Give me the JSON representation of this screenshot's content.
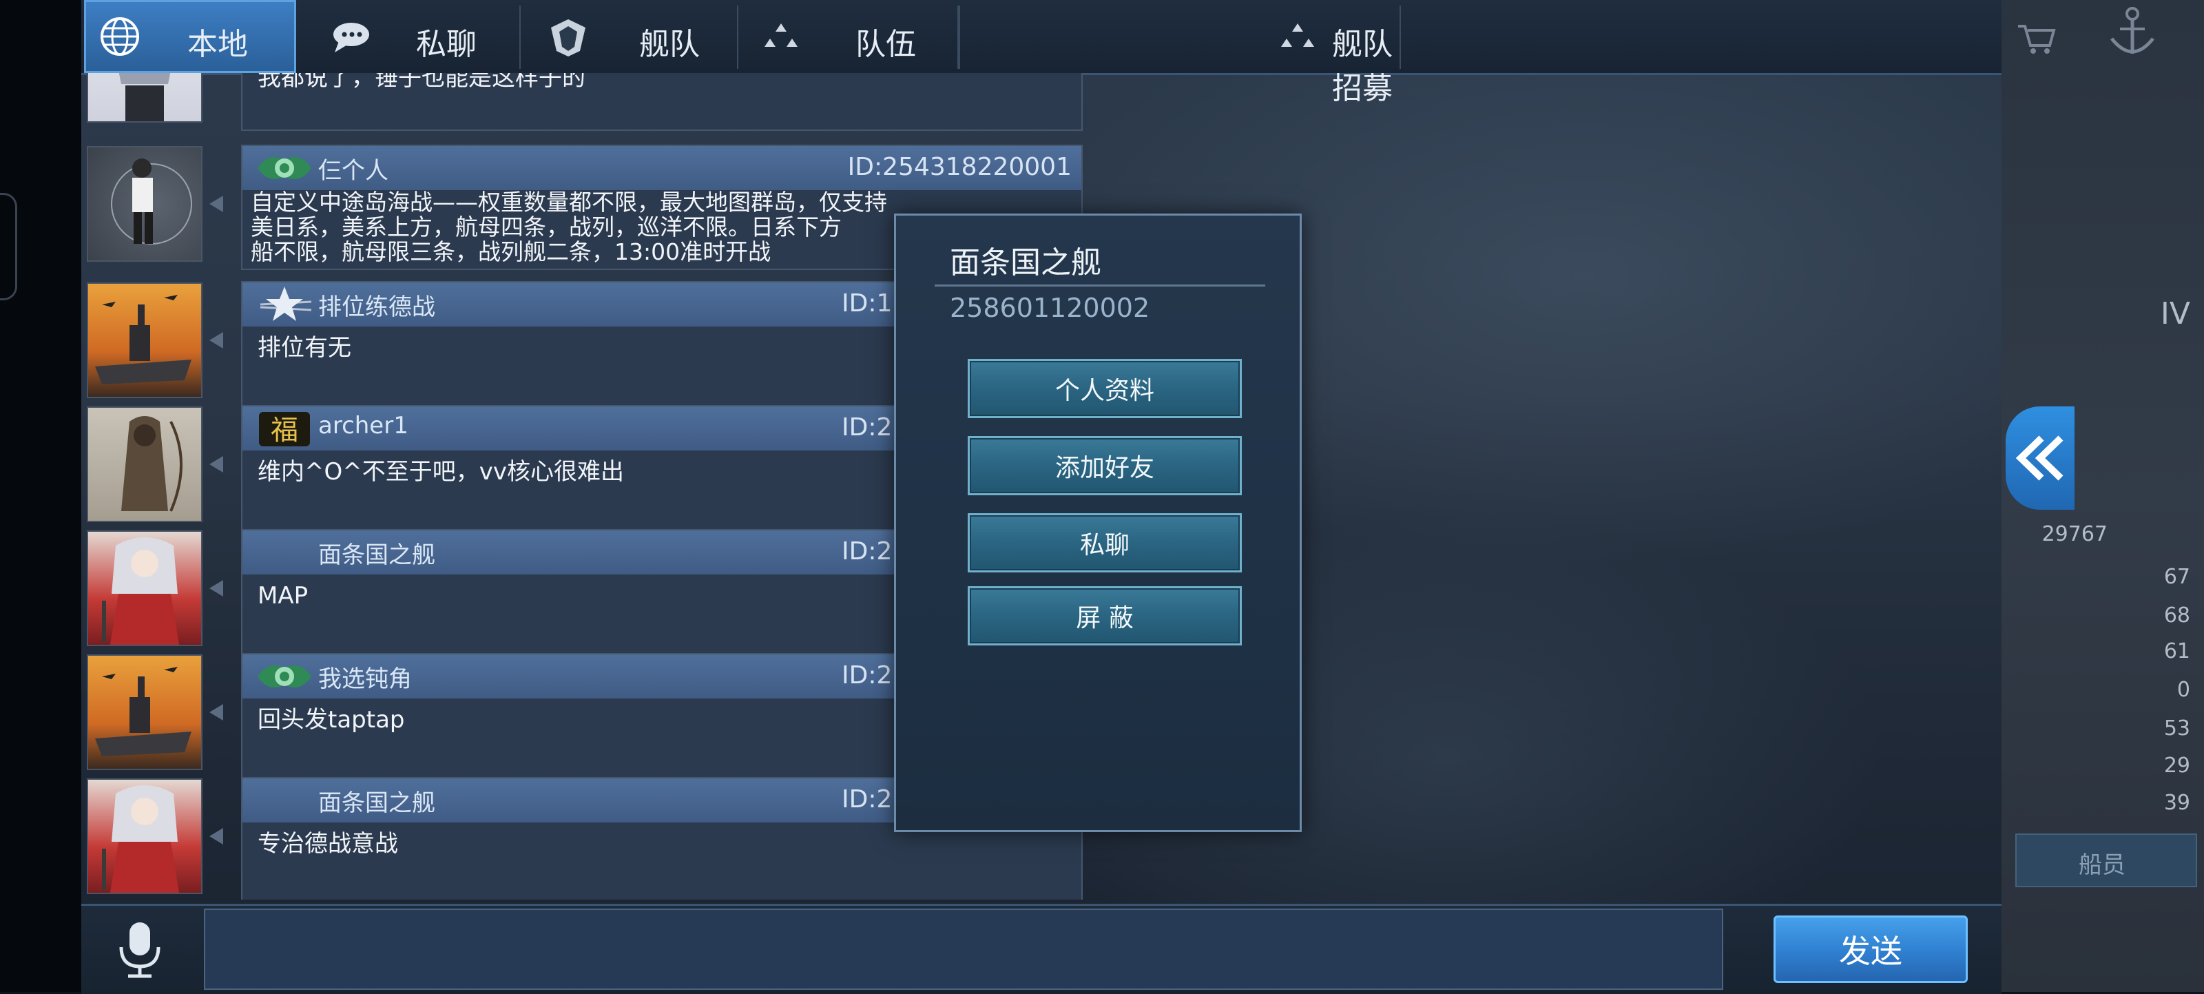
{
  "tabs": [
    {
      "label": "本地",
      "icon": "globe-icon",
      "active": true
    },
    {
      "label": "私聊",
      "icon": "speech-bubble-icon",
      "active": false
    },
    {
      "label": "舰队",
      "icon": "fleet-emblem-icon",
      "active": false
    },
    {
      "label": "队伍",
      "icon": "team-dots-icon",
      "active": false
    },
    {
      "label": "舰队招募",
      "icon": "team-dots-icon",
      "active": false
    }
  ],
  "messages": [
    {
      "name": "",
      "id": "",
      "text": "我都说了，锤子也能是这样子的",
      "avatar": "anime-girl-avatar",
      "badge": ""
    },
    {
      "name": "仨个人",
      "id": "ID:254318220001",
      "text": "自定义中途岛海战——权重数量都不限，最大地图群岛，仅支持\n美日系，美系上方，航母四条，战列，巡洋不限。日系下方\n船不限，航母限三条，战列舰二条，13:00准时开战",
      "avatar": "character-avatar",
      "badge": "wing-badge-icon"
    },
    {
      "name": "排位练德战",
      "id": "ID:1",
      "text": "排位有无",
      "avatar": "battleship-avatar",
      "badge": "star-badge-icon"
    },
    {
      "name": "archer1",
      "id": "ID:2",
      "text": "维内^O^不至于吧，vv核心很难出",
      "avatar": "archer-avatar",
      "badge": "fu-badge-icon"
    },
    {
      "name": "面条国之舰",
      "id": "ID:2",
      "text": "MAP",
      "avatar": "anime-warrior-avatar",
      "badge": ""
    },
    {
      "name": "我选钝角",
      "id": "ID:2",
      "text": "回头发taptap",
      "avatar": "battleship-avatar",
      "badge": "wing-badge-icon"
    },
    {
      "name": "面条国之舰",
      "id": "ID:2",
      "text": "专治德战意战",
      "avatar": "anime-warrior-avatar",
      "badge": ""
    }
  ],
  "popup": {
    "name": "面条国之舰",
    "id": "258601120002",
    "buttons": [
      "个人资料",
      "添加好友",
      "私聊",
      "屏 蔽"
    ]
  },
  "right_panel": {
    "stat_main": "29767",
    "level": "IV",
    "stats": [
      "67",
      "68",
      "61",
      "0",
      "53",
      "29",
      "39"
    ],
    "crew_label": "船员"
  },
  "input": {
    "value": "",
    "send_label": "发送"
  },
  "colors": {
    "active_tab": "#3e7fc5",
    "send_button": "#2f7fd0",
    "popup_button": "#2a6582"
  }
}
